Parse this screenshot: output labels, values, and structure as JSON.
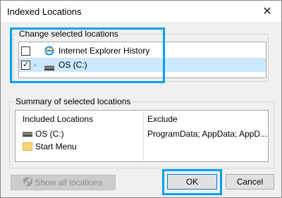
{
  "window": {
    "title": "Indexed Locations",
    "close_glyph": "✕"
  },
  "change_locations": {
    "group_label": "Change selected locations",
    "items": [
      {
        "label": "Internet Explorer History",
        "checked": false,
        "icon": "internet-explorer-icon"
      },
      {
        "label": "OS (C:)",
        "checked": true,
        "icon": "drive-icon",
        "expander": "›"
      }
    ]
  },
  "summary": {
    "group_label": "Summary of selected locations",
    "included_header": "Included Locations",
    "exclude_header": "Exclude",
    "included": [
      {
        "label": "OS (C:)",
        "icon": "drive-icon"
      },
      {
        "label": "Start Menu",
        "icon": "folder-icon"
      }
    ],
    "exclude": [
      "ProgramData; AppData; AppD..."
    ]
  },
  "buttons": {
    "show_all": "Show all locations",
    "ok": "OK",
    "cancel": "Cancel"
  },
  "colors": {
    "highlight": "#00a2e8",
    "selection": "#cce8ff",
    "primary_border": "#0078d7"
  }
}
